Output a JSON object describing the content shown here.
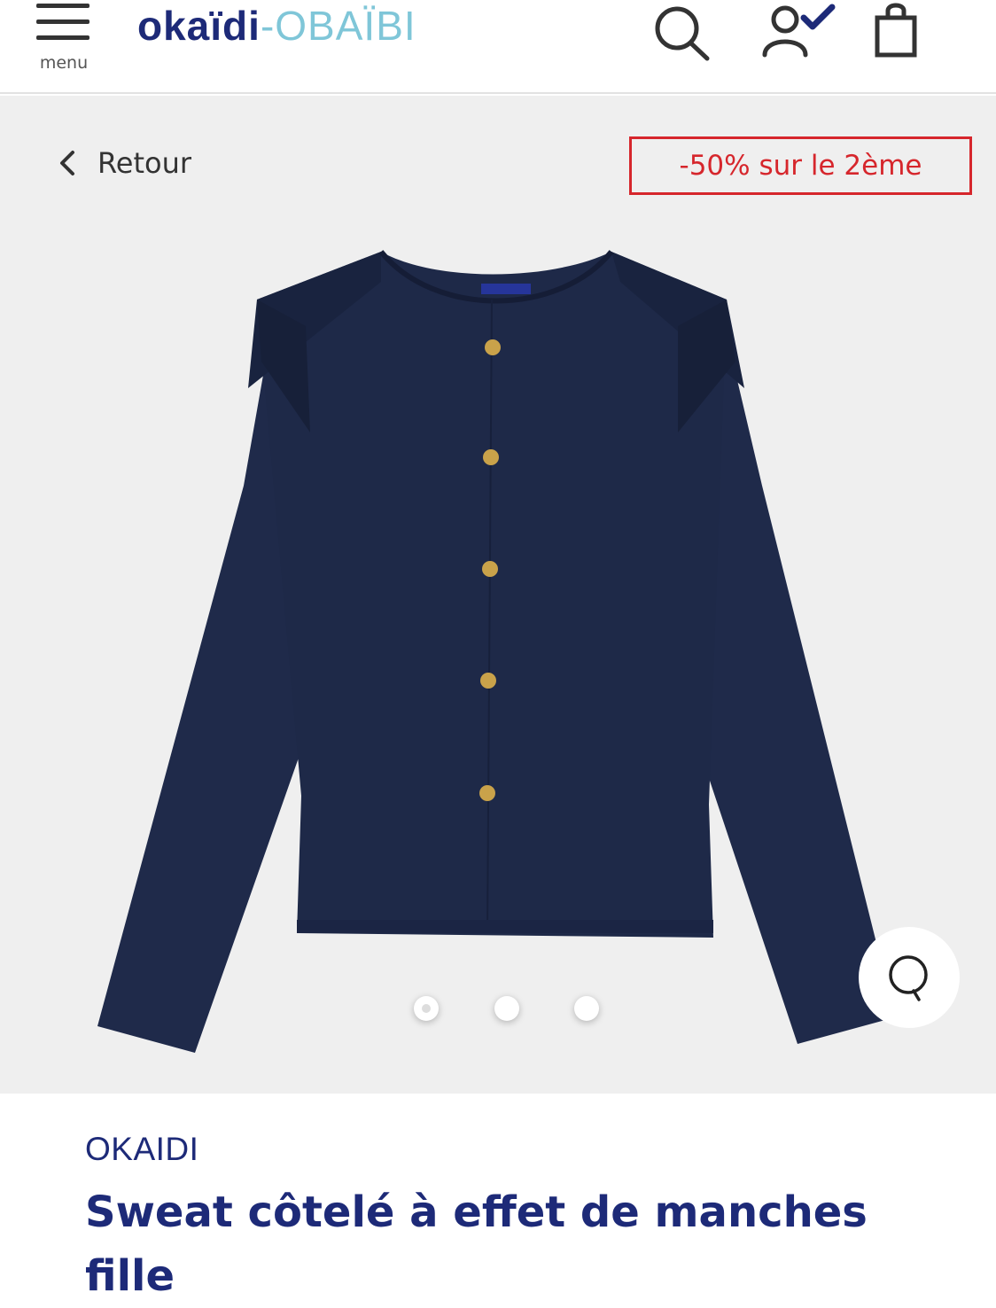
{
  "header": {
    "menu_label": "menu",
    "logo_primary": "okaïdi",
    "logo_separator": "-",
    "logo_secondary": "OBAÏBI",
    "icons": [
      "search-icon",
      "account-icon",
      "cart-icon"
    ]
  },
  "nav": {
    "back_label": "Retour"
  },
  "promo": {
    "label": "-50% sur le 2ème",
    "color": "#d6262c"
  },
  "gallery": {
    "image_count": 3,
    "active_index": 0
  },
  "product": {
    "brand": "OKAIDI",
    "title": "Sweat côtelé à effet de manches fille"
  },
  "colors": {
    "brand_navy": "#1d2a78",
    "logo_light": "#7fc6d8",
    "garment": "#1e2948",
    "button_gold": "#c9a24a",
    "background": "#efefef"
  }
}
